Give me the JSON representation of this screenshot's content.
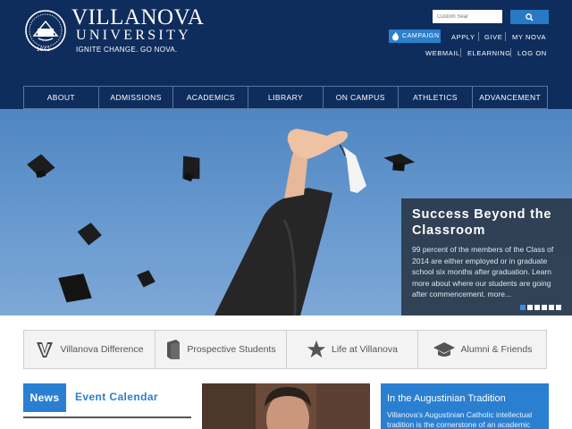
{
  "brand": {
    "name": "VILLANOVA",
    "sub": "UNIVERSITY",
    "tagline": "IGNITE CHANGE. GO NOVA.",
    "seal_year": "1842",
    "colors": {
      "navy": "#0f2d5c",
      "accent_blue": "#2b7fd1",
      "dark_panel": "#283444"
    }
  },
  "search": {
    "placeholder": "Custom Sear",
    "button_icon": "search-icon"
  },
  "utility": {
    "campaign": "CAMPAIGN",
    "campaign_icon": "flame-icon",
    "row1": [
      "APPLY",
      "GIVE",
      "MY NOVA"
    ],
    "row2": [
      "WEBMAIL",
      "ELEARNING",
      "LOG ON"
    ]
  },
  "nav": [
    "ABOUT",
    "ADMISSIONS",
    "ACADEMICS",
    "LIBRARY",
    "ON CAMPUS",
    "ATHLETICS",
    "ADVANCEMENT"
  ],
  "hero": {
    "title": "Success Beyond the Classroom",
    "body": "99 percent of the members of the Class of 2014 are either employed or in graduate school six months after graduation. Learn more about where our students are going after commencement. more...",
    "slides": {
      "count": 6,
      "active": 0
    }
  },
  "audiences": [
    {
      "label": "Villanova Difference",
      "icon": "v-logo-icon"
    },
    {
      "label": "Prospective Students",
      "icon": "book-icon"
    },
    {
      "label": "Life at Villanova",
      "icon": "star-icon"
    },
    {
      "label": "Alumni & Friends",
      "icon": "graduation-cap-icon"
    }
  ],
  "news": {
    "tab": "News",
    "event_tab": "Event Calendar"
  },
  "tradition": {
    "title": "In the Augustinian Tradition",
    "body": "Villanova's Augustinian Catholic intellectual tradition is the cornerstone of an academic"
  }
}
